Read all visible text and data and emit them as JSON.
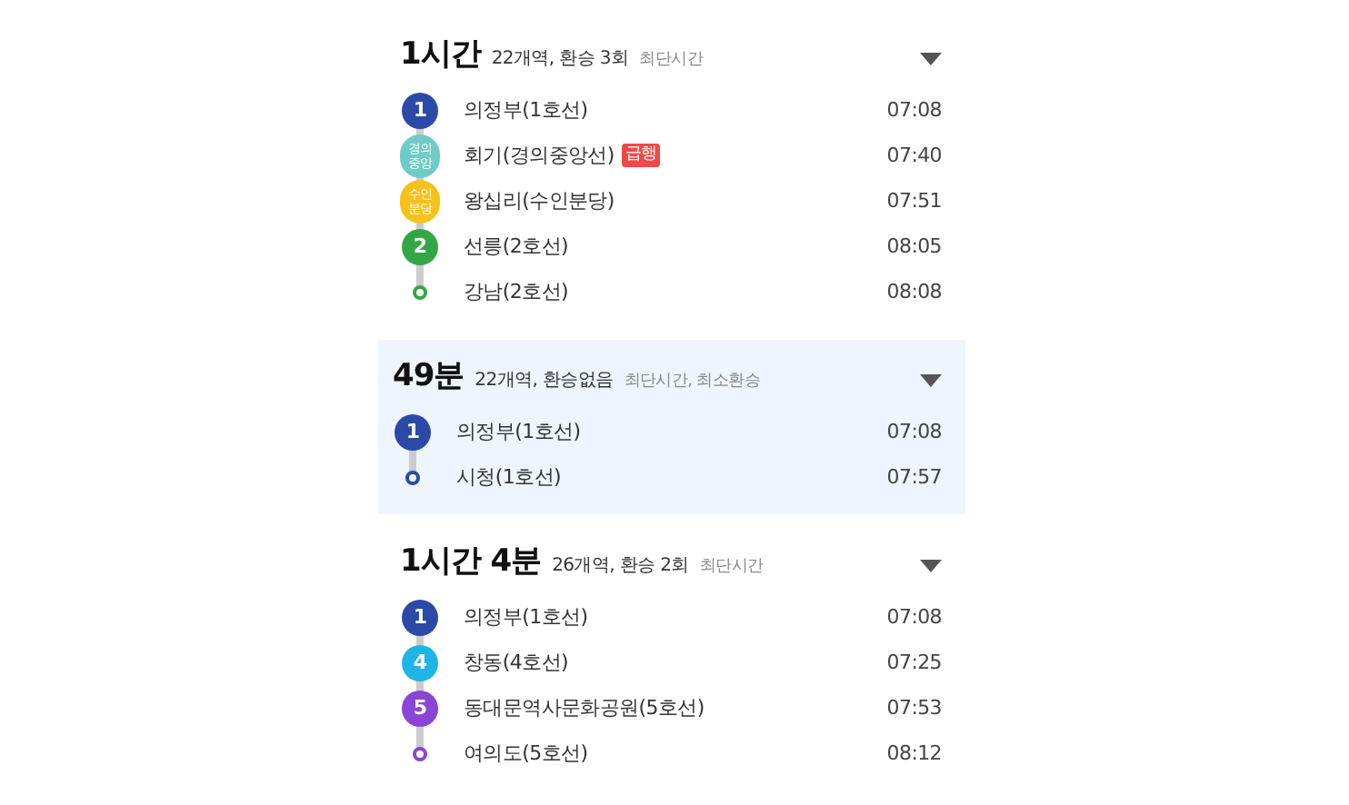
{
  "routes": [
    {
      "duration": "1시간",
      "summary": "22개역, 환승 3회",
      "tags": "최단시간",
      "selected": false,
      "stations": [
        {
          "kind": "badge",
          "badge": "1",
          "color": "#2b4aa8",
          "name": "의정부(1호선)",
          "time": "07:08"
        },
        {
          "kind": "badge",
          "badge": "경의\n중앙",
          "color": "#6fcbc6",
          "name": "회기(경의중앙선)",
          "tag": "급행",
          "time": "07:40"
        },
        {
          "kind": "badge",
          "badge": "수인\n분당",
          "color": "#f5c21a",
          "name": "왕십리(수인분당)",
          "time": "07:51"
        },
        {
          "kind": "badge",
          "badge": "2",
          "color": "#33a745",
          "name": "선릉(2호선)",
          "time": "08:05"
        },
        {
          "kind": "end",
          "color": "#33a745",
          "name": "강남(2호선)",
          "time": "08:08"
        }
      ]
    },
    {
      "duration": "49분",
      "summary": "22개역, 환승없음",
      "tags": "최단시간, 최소환승",
      "selected": true,
      "stations": [
        {
          "kind": "badge",
          "badge": "1",
          "color": "#2b4aa8",
          "name": "의정부(1호선)",
          "time": "07:08"
        },
        {
          "kind": "end",
          "color": "#2b4aa8",
          "name": "시청(1호선)",
          "time": "07:57"
        }
      ]
    },
    {
      "duration": "1시간 4분",
      "summary": "26개역, 환승 2회",
      "tags": "최단시간",
      "selected": false,
      "stations": [
        {
          "kind": "badge",
          "badge": "1",
          "color": "#2b4aa8",
          "name": "의정부(1호선)",
          "time": "07:08"
        },
        {
          "kind": "badge",
          "badge": "4",
          "color": "#1fb4e6",
          "name": "창동(4호선)",
          "time": "07:25"
        },
        {
          "kind": "badge",
          "badge": "5",
          "color": "#8a44d6",
          "name": "동대문역사문화공원(5호선)",
          "time": "07:53"
        },
        {
          "kind": "end",
          "color": "#8a44d6",
          "name": "여의도(5호선)",
          "time": "08:12"
        }
      ]
    }
  ]
}
